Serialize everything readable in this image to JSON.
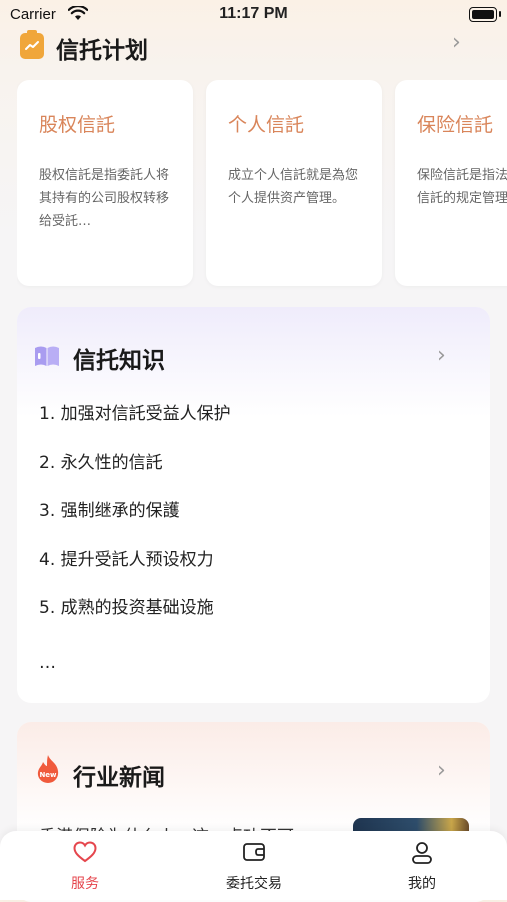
{
  "status_bar": {
    "carrier": "Carrier",
    "time": "11:17 PM"
  },
  "trust_plan": {
    "title": "信托计划",
    "icon": "chart-clipboard-icon",
    "cards": [
      {
        "title": "股权信託",
        "desc": "股权信託是指委託人将其持有的公司股权转移给受託…"
      },
      {
        "title": "个人信託",
        "desc": "成立个人信託就是為您个人提供资产管理。"
      },
      {
        "title": "保险信託",
        "desc": "保险信託是指法人按照信託的规定管理您"
      }
    ]
  },
  "knowledge": {
    "title": "信托知识",
    "icon": "book-icon",
    "items": [
      "1.  加强对信託受益人保护",
      "2.  永久性的信託",
      "3.  强制继承的保護",
      "4.  提升受託人预设权力",
      "5.  成熟的投资基础设施"
    ],
    "more": "…"
  },
  "news": {
    "title": "行业新闻",
    "icon": "fire-new-icon",
    "headline": "香港保险为什么火，这一点功不可"
  },
  "tab_bar": {
    "tabs": [
      {
        "label": "服务",
        "icon": "heart-icon",
        "active": true
      },
      {
        "label": "委托交易",
        "icon": "wallet-icon",
        "active": false
      },
      {
        "label": "我的",
        "icon": "person-icon",
        "active": false
      }
    ]
  },
  "colors": {
    "accent": "#e5464d",
    "card_title": "#d9855a",
    "plan_icon": "#f0a63a",
    "book_icon": "#a99cf0",
    "fire_icon": "#f05a3c"
  }
}
